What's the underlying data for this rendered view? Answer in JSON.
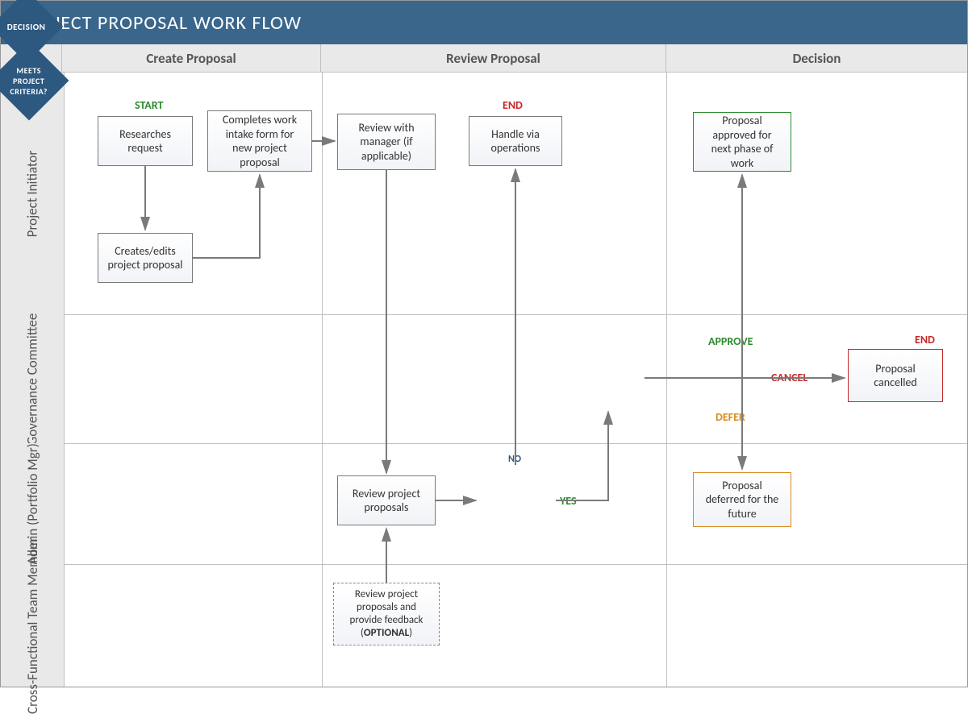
{
  "title": "PROJECT PROPOSAL WORK FLOW",
  "phases": {
    "p1": "Create Proposal",
    "p2": "Review Proposal",
    "p3": "Decision"
  },
  "lanes": {
    "l1": "Project Initiator",
    "l2": "Governance Committee",
    "l3": "Admin (Portfolio Mgr)",
    "l4": "Cross-Functional Team Member"
  },
  "nodes": {
    "researches": "Researches request",
    "creates": "Creates/edits project proposal",
    "completes": "Completes work intake form for new project proposal",
    "review_mgr": "Review with manager (if applicable)",
    "handle_ops": "Handle via operations",
    "review_proj": "Review project proposals",
    "criteria": "MEETS PROJECT CRITERIA?",
    "decision": "DECISION",
    "approved": "Proposal approved for next phase of work",
    "cancelled": "Proposal cancelled",
    "deferred": "Proposal deferred for the future",
    "cross_review": "Review project proposals and provide feedback (",
    "optional": "OPTIONAL",
    "close_paren": ")"
  },
  "labels": {
    "start": "START",
    "end1": "END",
    "end2": "END",
    "yes": "YES",
    "no": "NO",
    "approve": "APPROVE",
    "cancel": "CANCEL",
    "defer": "DEFER"
  }
}
